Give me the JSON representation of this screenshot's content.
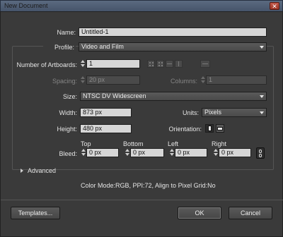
{
  "window": {
    "title": "New Document",
    "close_glyph": "✕"
  },
  "name": {
    "label": "Name:",
    "value": "Untitled-1"
  },
  "profile": {
    "label": "Profile:",
    "value": "Video and Film"
  },
  "artboards": {
    "label": "Number of Artboards:",
    "value": "1"
  },
  "spacing": {
    "label": "Spacing:",
    "value": "20 px"
  },
  "columns": {
    "label": "Columns:",
    "value": "1"
  },
  "size": {
    "label": "Size:",
    "value": "NTSC DV Widescreen"
  },
  "width": {
    "label": "Width:",
    "value": "873 px"
  },
  "units": {
    "label": "Units:",
    "value": "Pixels"
  },
  "height": {
    "label": "Height:",
    "value": "480 px"
  },
  "orientation": {
    "label": "Orientation:",
    "selected": "portrait"
  },
  "bleed": {
    "label": "Bleed:",
    "top": {
      "label": "Top",
      "value": "0 px"
    },
    "bottom": {
      "label": "Bottom",
      "value": "0 px"
    },
    "left": {
      "label": "Left",
      "value": "0 px"
    },
    "right": {
      "label": "Right",
      "value": "0 px"
    }
  },
  "advanced": {
    "label": "Advanced"
  },
  "summary": "Color Mode:RGB, PPI:72, Align to Pixel Grid:No",
  "buttons": {
    "templates": "Templates...",
    "ok": "OK",
    "cancel": "Cancel"
  },
  "icons": {
    "arrange": [
      "grid-by-row-icon",
      "grid-by-column-icon",
      "arrange-by-row-icon",
      "arrange-by-column-icon",
      "right-to-left-layout-icon"
    ],
    "link": "chain-link-icon"
  },
  "colors": {
    "dialog_bg": "#3a3a3a",
    "field_bg": "#d6d6d6",
    "titlebar": "#4f5d74"
  }
}
